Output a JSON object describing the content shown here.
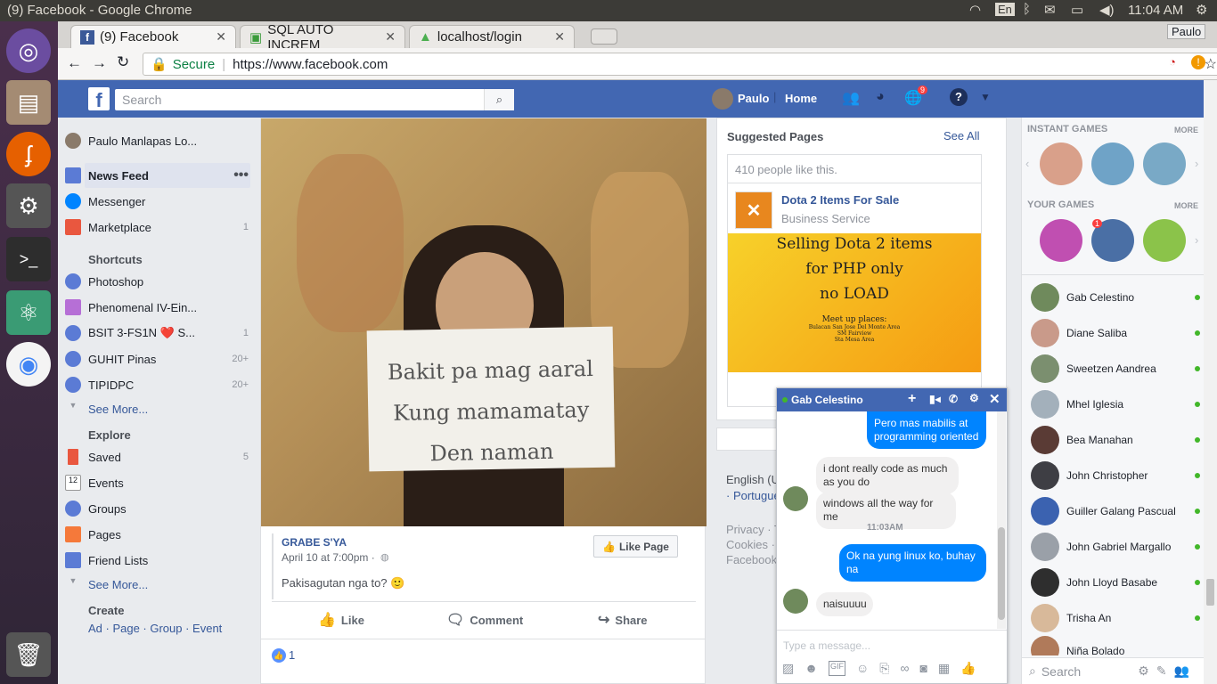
{
  "os": {
    "window_title": "(9) Facebook - Google Chrome",
    "lang": "En",
    "time": "11:04 AM",
    "user": "Paulo"
  },
  "tabs": [
    {
      "label": "(9) Facebook",
      "x": "✕"
    },
    {
      "label": "SQL AUTO INCREM",
      "x": "✕"
    },
    {
      "label": "localhost/login",
      "x": "✕"
    }
  ],
  "address": {
    "secure": "Secure",
    "url": "https://www.facebook.com"
  },
  "fb": {
    "search_placeholder": "Search",
    "user": "Paulo",
    "home": "Home",
    "notif_count": "9"
  },
  "profile_name": "Paulo Manlapas Lo...",
  "nav": [
    {
      "label": "News Feed",
      "count": ""
    },
    {
      "label": "Messenger",
      "count": ""
    },
    {
      "label": "Marketplace",
      "count": "1"
    }
  ],
  "shortcuts_title": "Shortcuts",
  "shortcuts": [
    {
      "label": "Photoshop",
      "count": ""
    },
    {
      "label": "Phenomenal IV-Ein...",
      "count": ""
    },
    {
      "label": "BSIT 3-FS1N ❤️ S...",
      "count": "1"
    },
    {
      "label": "GUHIT Pinas",
      "count": "20+"
    },
    {
      "label": "TIPIDPC",
      "count": "20+"
    }
  ],
  "see_more": "See More...",
  "explore_title": "Explore",
  "explore": [
    {
      "label": "Saved",
      "count": "5"
    },
    {
      "label": "Events",
      "count": ""
    },
    {
      "label": "Groups",
      "count": ""
    },
    {
      "label": "Pages",
      "count": ""
    },
    {
      "label": "Friend Lists",
      "count": ""
    }
  ],
  "create_title": "Create",
  "create_links": "Ad · Page · Group · Event",
  "post": {
    "sign_lines": [
      "Bakit pa mag aaral",
      "Kung mamamatay",
      "Den naman"
    ],
    "page": "GRABE S'YA",
    "date": "April 10 at 7:00pm ·",
    "text": "Pakisagutan nga to? 🙂",
    "like_page": "Like Page",
    "like": "Like",
    "comment": "Comment",
    "share": "Share",
    "reactions": "1"
  },
  "suggested": {
    "title": "Suggested Pages",
    "see_all": "See All",
    "likes": "410 people like this.",
    "page_name": "Dota 2 Items For Sale",
    "category": "Business Service",
    "img_lines": [
      "Selling Dota 2 items",
      "for PHP only",
      "no LOAD"
    ],
    "img_small": [
      "Meet up places:",
      "Bulacan San Jose Del Monte Area",
      "SM Fairview",
      "Sta Mesa Area"
    ]
  },
  "footer": {
    "lang": "English (U",
    "portugu": "· Portugue",
    "links1": "Privacy · T",
    "links2": "Cookies ·",
    "brand": "Facebook"
  },
  "chat": {
    "name": "Gab Celestino",
    "messages": [
      {
        "who": "me",
        "text": "Pero mas mabilis at programming oriented"
      },
      {
        "who": "them",
        "text": "i dont really code as much as you do"
      },
      {
        "who": "them",
        "text": "windows all the way for me"
      },
      {
        "who": "time",
        "text": "11:03AM"
      },
      {
        "who": "me",
        "text": "Ok na yung linux ko, buhay na"
      },
      {
        "who": "them",
        "text": "naisuuuu"
      }
    ],
    "placeholder": "Type a message..."
  },
  "games": {
    "instant": "INSTANT GAMES",
    "your": "YOUR GAMES",
    "more": "MORE",
    "badge": "1"
  },
  "friends": [
    "Gab Celestino",
    "Diane Saliba",
    "Sweetzen Aandrea",
    "Mhel Iglesia",
    "Bea Manahan",
    "John Christopher",
    "Guiller Galang Pascual",
    "John Gabriel Margallo",
    "John Lloyd Basabe",
    "Trisha An",
    "Niña Bolado"
  ],
  "sidebar_search": "Search"
}
